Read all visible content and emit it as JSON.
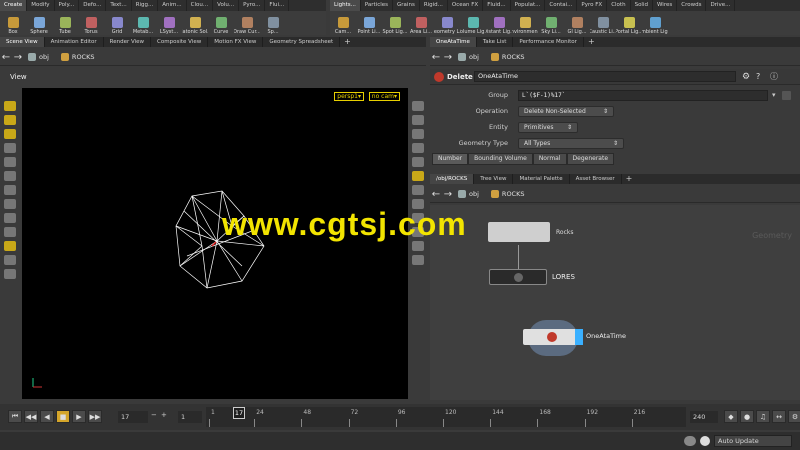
{
  "shelf_tabs_left": [
    "Create",
    "Modify",
    "Poly...",
    "Defo...",
    "Text...",
    "Rigg...",
    "Anim...",
    "Clou...",
    "Volu...",
    "Pyro...",
    "Flui..."
  ],
  "shelf_tabs_right": [
    "Lights...",
    "Particles",
    "Grains",
    "Rigid...",
    "Ocean FX",
    "Fluid...",
    "Populat...",
    "Contai...",
    "Pyro FX",
    "Cloth",
    "Solid",
    "Wires",
    "Crowds",
    "Drive..."
  ],
  "shelf_tools_left": [
    "Box",
    "Sphere",
    "Tube",
    "Torus",
    "Grid",
    "Metab...",
    "LSyst...",
    "Platonic Sol...",
    "Curve",
    "Draw Cur...",
    "Sp..."
  ],
  "shelf_tools_right": [
    "Cam...",
    "Point Li...",
    "Spot Lig...",
    "Area Li...",
    "Geometry L...",
    "Volume Lig...",
    "Distant Lig...",
    "Environmen...",
    "Sky Li...",
    "GI Lig...",
    "Caustic Li...",
    "Portal Lig...",
    "Ambient Lig..."
  ],
  "left_pane": {
    "tabs": [
      "Scene View",
      "Animation Editor",
      "Render View",
      "Composite View",
      "Motion FX View",
      "Geometry Spreadsheet"
    ],
    "path": {
      "root": "obj",
      "node": "ROCKS"
    },
    "view_label": "View",
    "persp": "persp1▾",
    "cam": "no cam▾"
  },
  "params_pane": {
    "tabs": [
      "OneAtaTime",
      "Take List",
      "Performance Monitor"
    ],
    "path": {
      "root": "obj",
      "node": "ROCKS"
    },
    "node_type": "Delete",
    "node_name": "OneAtaTime",
    "fields": {
      "group_label": "Group",
      "group_value": "L`($F-1)%17`",
      "operation_label": "Operation",
      "operation_value": "Delete Non-Selected",
      "entity_label": "Entity",
      "entity_value": "Primitives",
      "geometry_type_label": "Geometry Type",
      "geometry_type_value": "All Types"
    },
    "subtabs": [
      "Number",
      "Bounding Volume",
      "Normal",
      "Degenerate"
    ]
  },
  "network_pane": {
    "tabs": [
      "/obj/ROCKS",
      "Tree View",
      "Material Palette",
      "Asset Browser"
    ],
    "path": {
      "root": "obj",
      "node": "ROCKS"
    },
    "watermark": "Geometry",
    "nodes": {
      "top": "Rocks",
      "middle": "LORES",
      "bottom": "OneAtaTime"
    }
  },
  "overlay": {
    "watermark": "www.cgtsj.com"
  },
  "timeline": {
    "current_frame": "17",
    "step": "1",
    "ticks": [
      "1",
      "24",
      "48",
      "72",
      "96",
      "120",
      "144",
      "168",
      "192",
      "216"
    ],
    "marker": "17",
    "end_frame": "240"
  },
  "status": {
    "auto_update": "Auto Update"
  }
}
